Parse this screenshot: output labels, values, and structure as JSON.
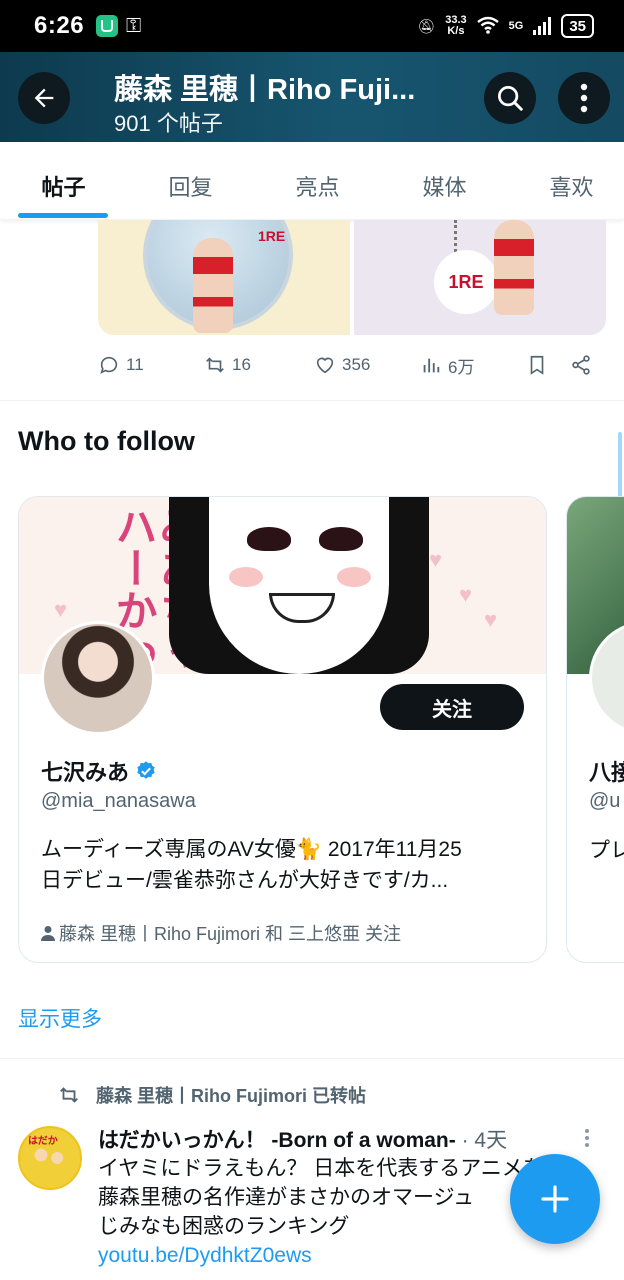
{
  "status_bar": {
    "time": "6:26",
    "net_speed_value": "33.3",
    "net_speed_unit": "K/s",
    "network": "5G",
    "battery": "35"
  },
  "header": {
    "title": "藤森 里穂丨Riho Fuji...",
    "subtitle": "901 个帖子"
  },
  "tabs": [
    {
      "label": "帖子",
      "active": true
    },
    {
      "label": "回复",
      "active": false
    },
    {
      "label": "亮点",
      "active": false
    },
    {
      "label": "媒体",
      "active": false
    },
    {
      "label": "喜欢",
      "active": false
    }
  ],
  "media": {
    "keychain_text": "1RE",
    "can_text": "1RE"
  },
  "post_actions": {
    "replies": "11",
    "reposts": "16",
    "likes": "356",
    "views": "6万"
  },
  "who_to_follow": {
    "title": "Who to follow",
    "cards": [
      {
        "banner_text": "みあちゃ ハーかわ",
        "follow_label": "关注",
        "name": "七沢みあ",
        "verified": true,
        "handle": "@mia_nanasawa",
        "bio_line1": "ムーディーズ専属のAV女優🐈 2017年11月25",
        "bio_line2": "日デビュー/雲雀恭弥さんが大好きです/カ...",
        "social": "藤森 里穂丨Riho Fujimori 和 三上悠亜 关注"
      },
      {
        "name": "八接",
        "handle": "@u",
        "bio": "プレ"
      }
    ],
    "show_more": "显示更多"
  },
  "retweet": {
    "context": "藤森 里穂丨Riho Fujimori 已转帖",
    "author": "はだかいっかん！ -Born of a woman-",
    "time": "· 4天",
    "avatar_text": "はだか",
    "line1": "イヤミにドラえもん？ 日本を代表するアニメを",
    "line2": "藤森里穂の名作達がまさかのオマージュ",
    "line3": "じみなも困惑のランキング",
    "link": "youtu.be/DydhktZ0ews"
  },
  "colors": {
    "accent": "#1d9bf0",
    "header_bg": "#17556f",
    "text": "#0f1419",
    "secondary": "#536471"
  },
  "icons": [
    "back-arrow-icon",
    "search-icon",
    "more-vertical-icon",
    "reply-icon",
    "repost-icon",
    "like-icon",
    "views-icon",
    "bookmark-icon",
    "share-icon",
    "verified-icon",
    "person-icon",
    "compose-plus-icon"
  ]
}
